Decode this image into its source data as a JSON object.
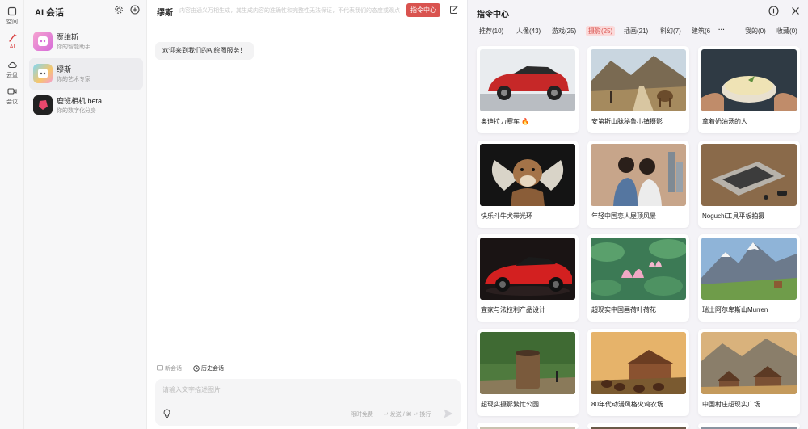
{
  "rail": {
    "items": [
      {
        "label": "空间",
        "icon": "square-icon"
      },
      {
        "label": "AI",
        "icon": "ai-wand-icon"
      },
      {
        "label": "云盘",
        "icon": "cloud-icon"
      },
      {
        "label": "会议",
        "icon": "video-icon"
      }
    ]
  },
  "conversations": {
    "title": "AI 会话",
    "items": [
      {
        "name": "贾维斯",
        "subtitle": "你的智能助手"
      },
      {
        "name": "缪斯",
        "subtitle": "你的艺术专家"
      },
      {
        "name": "鹿班相机 beta",
        "subtitle": "你的数字化分身"
      }
    ]
  },
  "chat": {
    "title": "缪斯",
    "description": "内容由通义万相生成，其生成内容的准确性和完整性无法保证，不代表我们的态度或观点",
    "command_button": "指令中心",
    "welcome": "欢迎来到我们的AI绘图服务！",
    "new_chat": "新会话",
    "history": "历史会话",
    "input_placeholder": "请输入文字描述图片",
    "free_limit": "限时免费",
    "send_hint": "↵ 发送 / ⌘ ↵ 换行"
  },
  "panel": {
    "title": "指令中心",
    "tabs": [
      "推荐(10)",
      "人像(43)",
      "游戏(25)",
      "摄影(25)",
      "插画(21)",
      "科幻(7)",
      "建筑(6"
    ],
    "more": "···",
    "mine": "我的(0)",
    "favorites": "收藏(0)",
    "cards": [
      "奥迪拉力赛车",
      "安第斯山脉秘鲁小镇摄影",
      "拿着奶油汤的人",
      "快乐斗牛犬带光环",
      "年轻中国恋人屋顶风景",
      "Noguchi工具平板拍摄",
      "宜家与法拉利产品设计",
      "超现实中国画荷叶荷花",
      "瑞士阿尔卑斯山Murren",
      "超现实摄影繁忙公园",
      "80年代动漫风格火鸡农场",
      "中国村庄超现实广场"
    ]
  },
  "colors": {
    "accent": "#d9534f",
    "active_tab_bg": "#fbdada"
  }
}
